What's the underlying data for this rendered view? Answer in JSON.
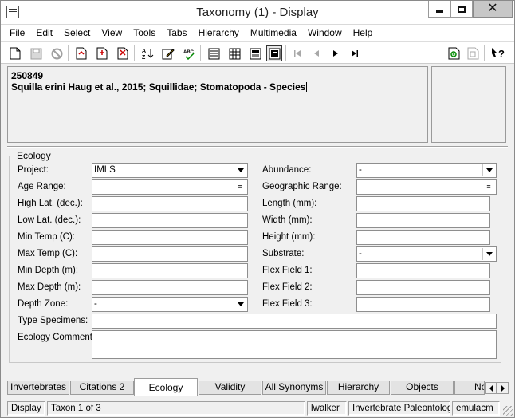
{
  "window": {
    "title": "Taxonomy (1) - Display",
    "close_glyph": "✕"
  },
  "menu": [
    "File",
    "Edit",
    "Select",
    "View",
    "Tools",
    "Tabs",
    "Hierarchy",
    "Multimedia",
    "Window",
    "Help"
  ],
  "toolbar_icons": [
    "new-record-icon",
    "save-icon",
    "cancel-icon",
    "open-icon",
    "add-icon",
    "delete-icon",
    "sort-icon",
    "edit-icon",
    "spell-check-icon",
    "details-view-icon",
    "grid-view-icon",
    "form-view-icon",
    "record-view-icon",
    "first-record-icon",
    "previous-record-icon",
    "next-record-icon",
    "last-record-icon",
    "attach-icon",
    "copy-icon",
    "help-icon"
  ],
  "record": {
    "id": "250849",
    "summary": "Squilla erini Haug et al., 2015; Squillidae; Stomatopoda - Species"
  },
  "ecology": {
    "legend": "Ecology",
    "left": [
      {
        "label": "Project:",
        "value": "IMLS",
        "kind": "combo"
      },
      {
        "label": "Age Range:",
        "value": "",
        "kind": "lookup"
      },
      {
        "label": "High Lat. (dec.):",
        "value": "",
        "kind": "text"
      },
      {
        "label": "Low Lat. (dec.):",
        "value": "",
        "kind": "text"
      },
      {
        "label": "Min Temp (C):",
        "value": "",
        "kind": "text"
      },
      {
        "label": "Max Temp (C):",
        "value": "",
        "kind": "text"
      },
      {
        "label": "Min Depth (m):",
        "value": "",
        "kind": "text"
      },
      {
        "label": "Max Depth (m):",
        "value": "",
        "kind": "text"
      },
      {
        "label": "Depth Zone:",
        "value": "-",
        "kind": "combo"
      }
    ],
    "right": [
      {
        "label": "Abundance:",
        "value": "-",
        "kind": "combo"
      },
      {
        "label": "Geographic Range:",
        "value": "",
        "kind": "lookup"
      },
      {
        "label": "Length (mm):",
        "value": "",
        "kind": "text"
      },
      {
        "label": "Width (mm):",
        "value": "",
        "kind": "text"
      },
      {
        "label": "Height (mm):",
        "value": "",
        "kind": "text"
      },
      {
        "label": "Substrate:",
        "value": "-",
        "kind": "combo"
      },
      {
        "label": "Flex Field 1:",
        "value": "",
        "kind": "text"
      },
      {
        "label": "Flex Field 2:",
        "value": "",
        "kind": "text"
      },
      {
        "label": "Flex Field 3:",
        "value": "",
        "kind": "text"
      }
    ],
    "type_specimens_label": "Type Specimens:",
    "type_specimens_value": "",
    "comments_label": "Ecology Comments:",
    "comments_value": ""
  },
  "tabs": [
    "Invertebrates",
    "Citations 2",
    "Ecology",
    "Validity",
    "All Synonyms",
    "Hierarchy",
    "Objects",
    "Notes"
  ],
  "active_tab": "Ecology",
  "status": {
    "mode": "Display",
    "position": "Taxon 1 of 3",
    "user": "lwalker",
    "department": "Invertebrate Paleontology",
    "machine": "emulacm"
  }
}
